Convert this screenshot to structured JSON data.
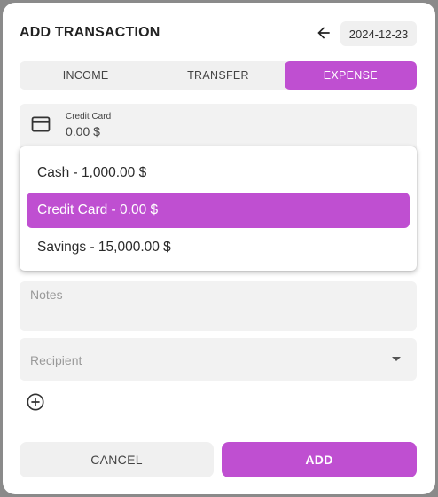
{
  "dialog": {
    "title": "ADD TRANSACTION",
    "date": "2024-12-23"
  },
  "tabs": [
    {
      "label": "INCOME",
      "active": false
    },
    {
      "label": "TRANSFER",
      "active": false
    },
    {
      "label": "EXPENSE",
      "active": true
    }
  ],
  "account": {
    "label": "Credit Card",
    "value": "0.00 $"
  },
  "dropdown": {
    "options": [
      {
        "label": "Cash - 1,000.00 $",
        "selected": false
      },
      {
        "label": "Credit Card - 0.00 $",
        "selected": true
      },
      {
        "label": "Savings - 15,000.00 $",
        "selected": false
      }
    ]
  },
  "notes": {
    "placeholder": "Notes"
  },
  "recipient": {
    "placeholder": "Recipient"
  },
  "buttons": {
    "cancel": "CANCEL",
    "add": "ADD"
  },
  "colors": {
    "accent": "#bf4fd1",
    "field_bg": "#f2f2f2"
  },
  "icons": {
    "back": "arrow-left-icon",
    "account": "credit-card-icon",
    "recipient_caret": "caret-down-icon",
    "add_split": "plus-circle-icon"
  }
}
